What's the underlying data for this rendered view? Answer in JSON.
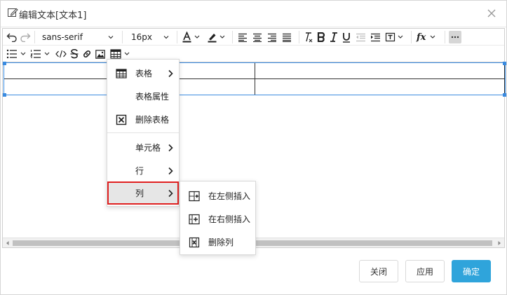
{
  "dialog": {
    "title": "编辑文本[文本1]"
  },
  "toolbar": {
    "font_family": "sans-serif",
    "font_size": "16px"
  },
  "table_menu": {
    "items": [
      {
        "label": "表格",
        "icon": "table-icon",
        "has_submenu": true
      },
      {
        "label": "表格属性",
        "icon": "",
        "has_submenu": false
      },
      {
        "label": "删除表格",
        "icon": "delete-table-icon",
        "has_submenu": false
      },
      {
        "label": "单元格",
        "icon": "",
        "has_submenu": true
      },
      {
        "label": "行",
        "icon": "",
        "has_submenu": true
      },
      {
        "label": "列",
        "icon": "",
        "has_submenu": true,
        "active": true
      }
    ]
  },
  "column_submenu": {
    "items": [
      {
        "label": "在左侧插入",
        "icon": "insert-column-left-icon"
      },
      {
        "label": "在右侧插入",
        "icon": "insert-column-right-icon"
      },
      {
        "label": "删除列",
        "icon": "delete-column-icon"
      }
    ]
  },
  "footer": {
    "close_label": "关闭",
    "apply_label": "应用",
    "confirm_label": "确定"
  },
  "colors": {
    "primary": "#2fa4db",
    "selection": "#3a8be0",
    "highlight_border": "#e02020"
  }
}
